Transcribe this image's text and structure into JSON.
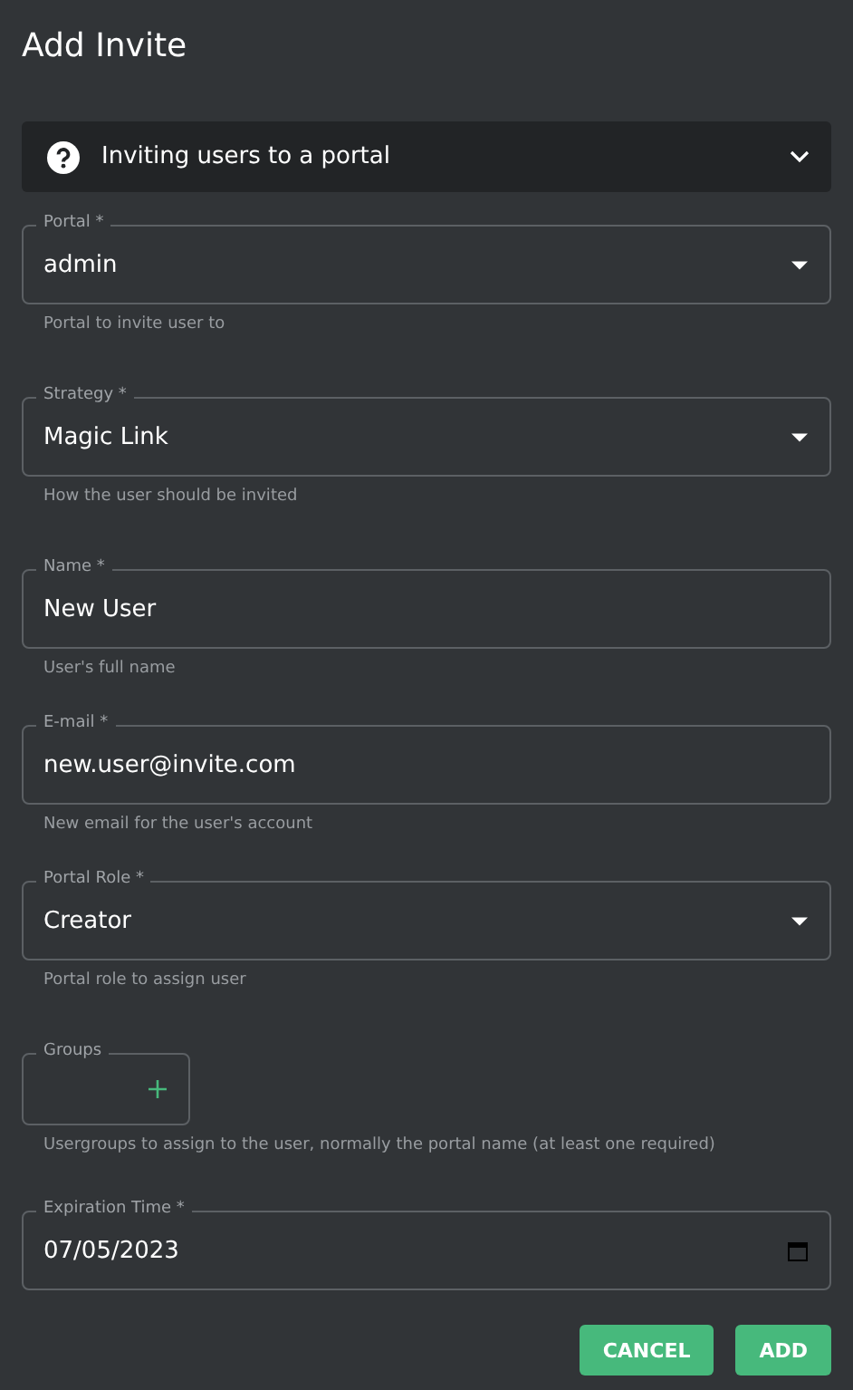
{
  "dialog": {
    "title": "Add Invite"
  },
  "info_panel": {
    "title": "Inviting users to a portal",
    "expanded": false
  },
  "fields": [
    {
      "kind": "select",
      "label": "Portal *",
      "value": "admin",
      "helper": "Portal to invite user to"
    },
    {
      "kind": "select",
      "label": "Strategy *",
      "value": "Magic Link",
      "helper": "How the user should be invited"
    },
    {
      "kind": "text",
      "label": "Name *",
      "value": "New User",
      "helper": "User's full name"
    },
    {
      "kind": "text",
      "label": "E-mail *",
      "value": "new.user@invite.com",
      "helper": "New email for the user's account"
    },
    {
      "kind": "select",
      "label": "Portal Role *",
      "value": "Creator",
      "helper": "Portal role to assign user"
    },
    {
      "kind": "groups",
      "label": "Groups",
      "helper": "Usergroups to assign to the user, normally the portal name (at least one required)"
    },
    {
      "kind": "date",
      "label": "Expiration Time *",
      "value": "07/05/2023"
    }
  ],
  "buttons": [
    "CANCEL",
    "ADD"
  ]
}
